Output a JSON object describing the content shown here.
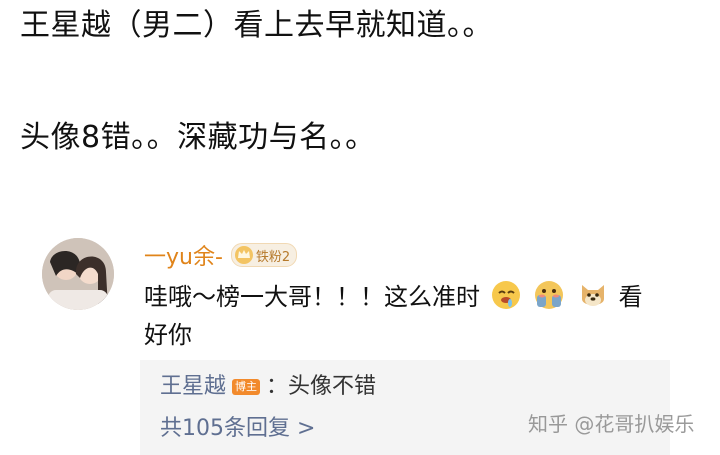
{
  "captions": {
    "line1": "王星越（男二）看上去早就知道。。",
    "line2": "头像8错。。深藏功与名。。"
  },
  "comment": {
    "username": "一yu余-",
    "fan_badge": "铁粉2",
    "body_line1": "哇哦～榜一大哥！！！这么准时",
    "body_line1_tail": "看",
    "body_line2": "好你",
    "emojis": [
      "drooling-face-icon",
      "shy-face-icon",
      "doge-icon"
    ],
    "colors": {
      "username": "#e0841a",
      "link": "#5f6f91",
      "host_badge": "#f28a2c"
    }
  },
  "reply": {
    "author": "王星越",
    "author_badge": "博主",
    "text": "：头像不错",
    "count_label": "共105条回复 >"
  },
  "watermark": "知乎 @花哥扒娱乐"
}
